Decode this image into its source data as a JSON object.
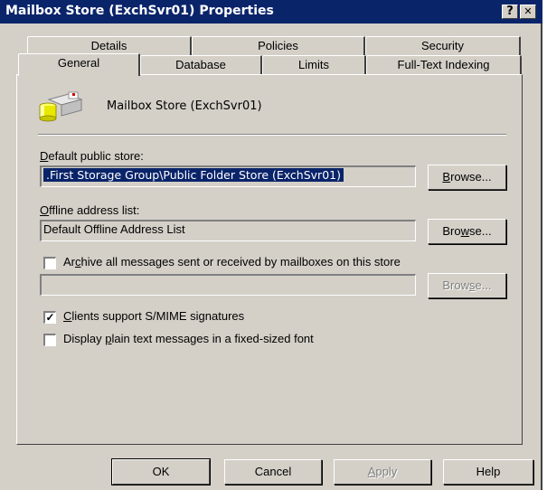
{
  "window": {
    "title": "Mailbox Store (ExchSvr01) Properties",
    "help_button": "?",
    "close_button": "✕"
  },
  "tabs": {
    "row_back": [
      "Details",
      "Policies",
      "Security"
    ],
    "row_front": [
      "General",
      "Database",
      "Limits",
      "Full-Text Indexing"
    ],
    "selected": "General"
  },
  "header": {
    "store_name": "Mailbox Store (ExchSvr01)"
  },
  "default_public_store": {
    "label_pre": "",
    "label_accel": "D",
    "label_post": "efault public store:",
    "value": ".First Storage Group\\Public Folder Store (ExchSvr01)",
    "browse_pre": "",
    "browse_accel": "B",
    "browse_post": "rowse..."
  },
  "offline_address_list": {
    "label_pre": "",
    "label_accel": "O",
    "label_post": "ffline address list:",
    "value": "Default Offline Address List",
    "browse_pre": "Bro",
    "browse_accel": "w",
    "browse_post": "se..."
  },
  "archive": {
    "checked": false,
    "label_pre": "Ar",
    "label_accel": "c",
    "label_post": "hive all messages sent or received by mailboxes on this store",
    "value": "",
    "browse_pre": "Brow",
    "browse_accel": "s",
    "browse_post": "e..."
  },
  "smime": {
    "checked": true,
    "check_mark": "✓",
    "label_pre": "",
    "label_accel": "C",
    "label_post": "lients support S/MIME signatures"
  },
  "plain_text": {
    "checked": false,
    "label_pre": "Display ",
    "label_accel": "p",
    "label_post": "lain text messages in a fixed-sized font"
  },
  "buttons": {
    "ok": "OK",
    "cancel": "Cancel",
    "apply_pre": "",
    "apply_accel": "A",
    "apply_post": "pply",
    "help": "Help"
  },
  "colors": {
    "titlebar": "#0a246a",
    "face": "#d4d0c8",
    "selection": "#0a246a"
  }
}
